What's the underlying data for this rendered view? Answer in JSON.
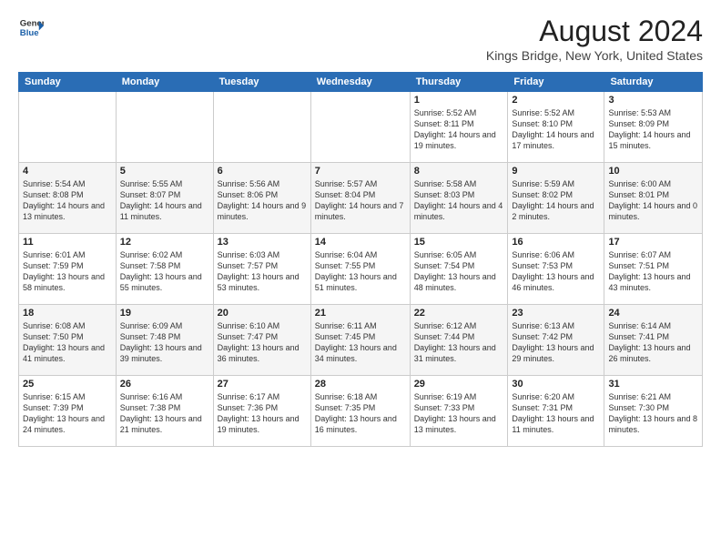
{
  "header": {
    "logo": {
      "general": "General",
      "blue": "Blue"
    },
    "title": "August 2024",
    "location": "Kings Bridge, New York, United States"
  },
  "weekdays": [
    "Sunday",
    "Monday",
    "Tuesday",
    "Wednesday",
    "Thursday",
    "Friday",
    "Saturday"
  ],
  "weeks": [
    [
      {
        "day": "",
        "info": ""
      },
      {
        "day": "",
        "info": ""
      },
      {
        "day": "",
        "info": ""
      },
      {
        "day": "",
        "info": ""
      },
      {
        "day": "1",
        "info": "Sunrise: 5:52 AM\nSunset: 8:11 PM\nDaylight: 14 hours\nand 19 minutes."
      },
      {
        "day": "2",
        "info": "Sunrise: 5:52 AM\nSunset: 8:10 PM\nDaylight: 14 hours\nand 17 minutes."
      },
      {
        "day": "3",
        "info": "Sunrise: 5:53 AM\nSunset: 8:09 PM\nDaylight: 14 hours\nand 15 minutes."
      }
    ],
    [
      {
        "day": "4",
        "info": "Sunrise: 5:54 AM\nSunset: 8:08 PM\nDaylight: 14 hours\nand 13 minutes."
      },
      {
        "day": "5",
        "info": "Sunrise: 5:55 AM\nSunset: 8:07 PM\nDaylight: 14 hours\nand 11 minutes."
      },
      {
        "day": "6",
        "info": "Sunrise: 5:56 AM\nSunset: 8:06 PM\nDaylight: 14 hours\nand 9 minutes."
      },
      {
        "day": "7",
        "info": "Sunrise: 5:57 AM\nSunset: 8:04 PM\nDaylight: 14 hours\nand 7 minutes."
      },
      {
        "day": "8",
        "info": "Sunrise: 5:58 AM\nSunset: 8:03 PM\nDaylight: 14 hours\nand 4 minutes."
      },
      {
        "day": "9",
        "info": "Sunrise: 5:59 AM\nSunset: 8:02 PM\nDaylight: 14 hours\nand 2 minutes."
      },
      {
        "day": "10",
        "info": "Sunrise: 6:00 AM\nSunset: 8:01 PM\nDaylight: 14 hours\nand 0 minutes."
      }
    ],
    [
      {
        "day": "11",
        "info": "Sunrise: 6:01 AM\nSunset: 7:59 PM\nDaylight: 13 hours\nand 58 minutes."
      },
      {
        "day": "12",
        "info": "Sunrise: 6:02 AM\nSunset: 7:58 PM\nDaylight: 13 hours\nand 55 minutes."
      },
      {
        "day": "13",
        "info": "Sunrise: 6:03 AM\nSunset: 7:57 PM\nDaylight: 13 hours\nand 53 minutes."
      },
      {
        "day": "14",
        "info": "Sunrise: 6:04 AM\nSunset: 7:55 PM\nDaylight: 13 hours\nand 51 minutes."
      },
      {
        "day": "15",
        "info": "Sunrise: 6:05 AM\nSunset: 7:54 PM\nDaylight: 13 hours\nand 48 minutes."
      },
      {
        "day": "16",
        "info": "Sunrise: 6:06 AM\nSunset: 7:53 PM\nDaylight: 13 hours\nand 46 minutes."
      },
      {
        "day": "17",
        "info": "Sunrise: 6:07 AM\nSunset: 7:51 PM\nDaylight: 13 hours\nand 43 minutes."
      }
    ],
    [
      {
        "day": "18",
        "info": "Sunrise: 6:08 AM\nSunset: 7:50 PM\nDaylight: 13 hours\nand 41 minutes."
      },
      {
        "day": "19",
        "info": "Sunrise: 6:09 AM\nSunset: 7:48 PM\nDaylight: 13 hours\nand 39 minutes."
      },
      {
        "day": "20",
        "info": "Sunrise: 6:10 AM\nSunset: 7:47 PM\nDaylight: 13 hours\nand 36 minutes."
      },
      {
        "day": "21",
        "info": "Sunrise: 6:11 AM\nSunset: 7:45 PM\nDaylight: 13 hours\nand 34 minutes."
      },
      {
        "day": "22",
        "info": "Sunrise: 6:12 AM\nSunset: 7:44 PM\nDaylight: 13 hours\nand 31 minutes."
      },
      {
        "day": "23",
        "info": "Sunrise: 6:13 AM\nSunset: 7:42 PM\nDaylight: 13 hours\nand 29 minutes."
      },
      {
        "day": "24",
        "info": "Sunrise: 6:14 AM\nSunset: 7:41 PM\nDaylight: 13 hours\nand 26 minutes."
      }
    ],
    [
      {
        "day": "25",
        "info": "Sunrise: 6:15 AM\nSunset: 7:39 PM\nDaylight: 13 hours\nand 24 minutes."
      },
      {
        "day": "26",
        "info": "Sunrise: 6:16 AM\nSunset: 7:38 PM\nDaylight: 13 hours\nand 21 minutes."
      },
      {
        "day": "27",
        "info": "Sunrise: 6:17 AM\nSunset: 7:36 PM\nDaylight: 13 hours\nand 19 minutes."
      },
      {
        "day": "28",
        "info": "Sunrise: 6:18 AM\nSunset: 7:35 PM\nDaylight: 13 hours\nand 16 minutes."
      },
      {
        "day": "29",
        "info": "Sunrise: 6:19 AM\nSunset: 7:33 PM\nDaylight: 13 hours\nand 13 minutes."
      },
      {
        "day": "30",
        "info": "Sunrise: 6:20 AM\nSunset: 7:31 PM\nDaylight: 13 hours\nand 11 minutes."
      },
      {
        "day": "31",
        "info": "Sunrise: 6:21 AM\nSunset: 7:30 PM\nDaylight: 13 hours\nand 8 minutes."
      }
    ]
  ]
}
